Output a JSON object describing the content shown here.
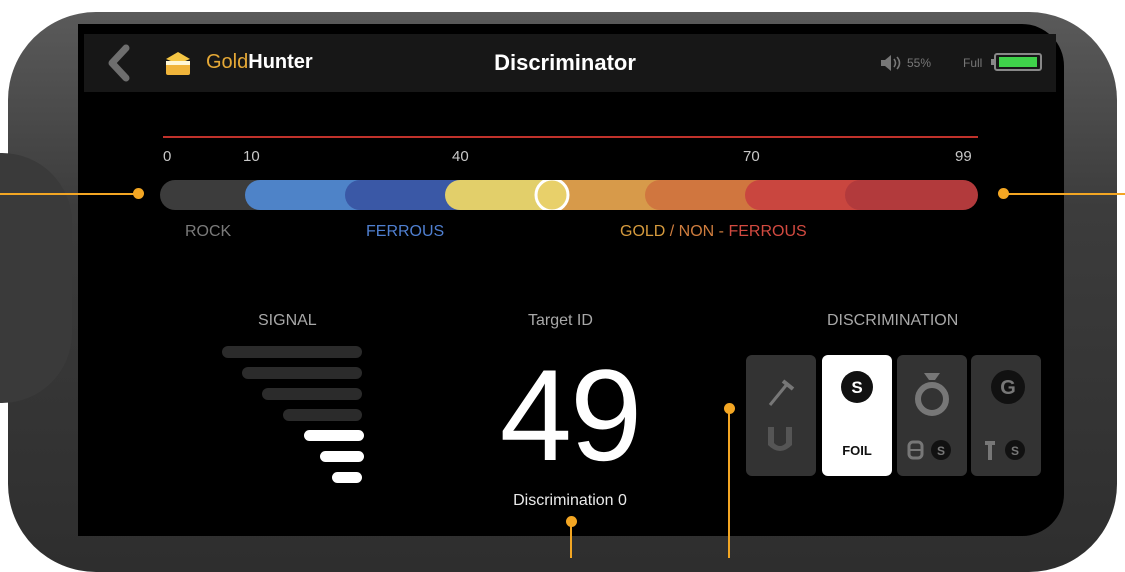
{
  "header": {
    "brand_gold": "Gold",
    "brand_hunter": "Hunter",
    "title": "Discriminator",
    "volume": "55%",
    "battery_label": "Full"
  },
  "scale": {
    "ticks": [
      "0",
      "10",
      "40",
      "70",
      "99"
    ],
    "categories": {
      "rock": "ROCK",
      "ferrous": "FERROUS",
      "gold": "GOLD",
      "separator": " / NON - ",
      "nonferrous": "FERROUS"
    },
    "colors": {
      "rock": "#3c3c3c",
      "ferrous_light": "#4e83c8",
      "ferrous_dark": "#3a58a6",
      "yellow": "#e2cf6a",
      "gold": "#d79a4a",
      "orange": "#d0763f",
      "red": "#c9463f",
      "dark_red": "#b23a3c",
      "accent": "#f3a623"
    },
    "slider_value": 49
  },
  "signal": {
    "label": "SIGNAL",
    "level": 4,
    "levels_total": 8
  },
  "target": {
    "label": "Target ID",
    "value": "49",
    "discrimination": "Discrimination 0"
  },
  "discrimination": {
    "label": "DISCRIMINATION",
    "tiles": [
      {
        "name": "nail-magnet",
        "active": false
      },
      {
        "name": "foil",
        "letter": "S",
        "text": "FOIL",
        "active": true
      },
      {
        "name": "ring",
        "letter": "S",
        "active": false
      },
      {
        "name": "screw",
        "letter": "G",
        "sub_letter": "S",
        "active": false
      }
    ]
  }
}
